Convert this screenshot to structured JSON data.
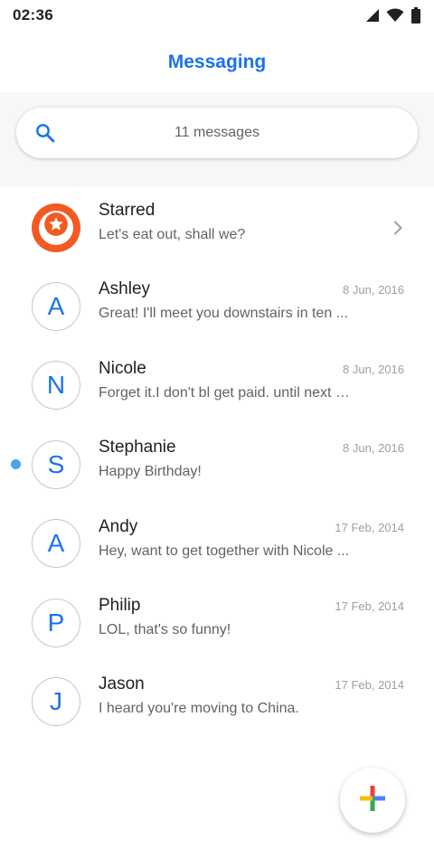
{
  "status_bar": {
    "time": "02:36"
  },
  "app_bar": {
    "title": "Messaging"
  },
  "search": {
    "placeholder": "11 messages"
  },
  "conversations": [
    {
      "name": "Starred",
      "date": "",
      "snippet": "Let's eat out, shall we?",
      "initial": "",
      "starred": true
    },
    {
      "name": "Ashley",
      "date": "8 Jun, 2016",
      "snippet": "Great! I'll meet you downstairs in ten ...",
      "initial": "A"
    },
    {
      "name": "Nicole",
      "date": "8 Jun, 2016",
      "snippet": "Forget it.I don't bl get paid. until next F...",
      "initial": "N"
    },
    {
      "name": "Stephanie",
      "date": "8 Jun, 2016",
      "snippet": "Happy Birthday!",
      "initial": "S",
      "unread": true
    },
    {
      "name": "Andy",
      "date": "17 Feb, 2014",
      "snippet": "Hey, want to get together with Nicole ...",
      "initial": "A"
    },
    {
      "name": "Philip",
      "date": "17 Feb, 2014",
      "snippet": "LOL, that's so funny!",
      "initial": "P"
    },
    {
      "name": "Jason",
      "date": "17 Feb, 2014",
      "snippet": "I heard you're moving to China.",
      "initial": "J"
    }
  ],
  "colors": {
    "accent": "#1a73e8",
    "starred_badge": "#f25a22",
    "unread_dot": "#42a5f5"
  },
  "icons": {
    "search": "search-icon",
    "signal": "cell-signal-icon",
    "wifi": "wifi-icon",
    "battery": "battery-icon",
    "star": "star-icon",
    "chevron": "chevron-right-icon",
    "fab": "plus-icon"
  }
}
